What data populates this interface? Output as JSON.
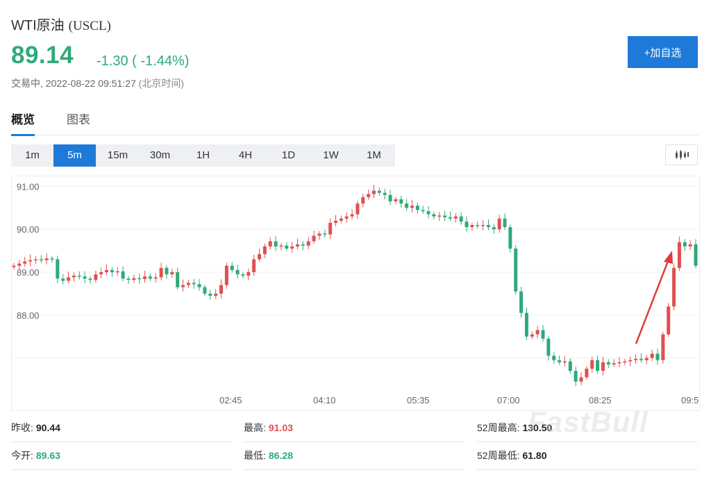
{
  "header": {
    "name": "WTI原油",
    "symbol": "(USCL)",
    "price": "89.14",
    "change": "-1.30 ( -1.44%)",
    "status": "交易中,",
    "timestamp": "2022-08-22 09:51:27",
    "timezone": "(北京时间)",
    "add_button": "+加自选"
  },
  "tabs": [
    {
      "label": "概览",
      "active": true
    },
    {
      "label": "图表",
      "active": false
    }
  ],
  "periods": [
    {
      "label": "1m",
      "active": false
    },
    {
      "label": "5m",
      "active": true
    },
    {
      "label": "15m",
      "active": false
    },
    {
      "label": "30m",
      "active": false
    },
    {
      "label": "1H",
      "active": false
    },
    {
      "label": "4H",
      "active": false
    },
    {
      "label": "1D",
      "active": false
    },
    {
      "label": "1W",
      "active": false
    },
    {
      "label": "1M",
      "active": false
    }
  ],
  "chart_type_icon": "candlestick-icon",
  "colors": {
    "up": "#e05050",
    "down": "#2eaa7a",
    "accent": "#1e7ad9"
  },
  "chart_data": {
    "type": "candlestick",
    "y_ticks": [
      "91.00",
      "90.00",
      "89.00",
      "88.00"
    ],
    "y_tick_values": [
      91,
      90,
      89,
      88
    ],
    "x_ticks": [
      "02:45",
      "04:10",
      "05:35",
      "07:00",
      "08:25",
      "09:5"
    ],
    "ylim": [
      86.2,
      91.25
    ],
    "close": [
      89.15,
      89.2,
      89.25,
      89.28,
      89.3,
      89.28,
      89.32,
      89.3,
      88.85,
      88.8,
      88.88,
      88.92,
      88.9,
      88.85,
      88.82,
      88.95,
      89.0,
      89.05,
      89.0,
      89.02,
      88.85,
      88.82,
      88.86,
      88.84,
      88.9,
      88.85,
      88.88,
      89.1,
      88.95,
      89.0,
      88.65,
      88.7,
      88.75,
      88.72,
      88.65,
      88.5,
      88.45,
      88.5,
      88.7,
      89.15,
      89.05,
      88.95,
      88.92,
      89.0,
      89.3,
      89.42,
      89.6,
      89.72,
      89.6,
      89.62,
      89.55,
      89.6,
      89.65,
      89.62,
      89.72,
      89.85,
      89.9,
      89.88,
      90.15,
      90.2,
      90.25,
      90.3,
      90.35,
      90.6,
      90.75,
      90.82,
      90.9,
      90.85,
      90.8,
      90.65,
      90.7,
      90.6,
      90.5,
      90.55,
      90.45,
      90.42,
      90.35,
      90.3,
      90.32,
      90.28,
      90.25,
      90.3,
      90.18,
      90.05,
      90.1,
      90.08,
      90.1,
      90.05,
      90.0,
      90.25,
      90.05,
      89.55,
      88.55,
      88.05,
      87.5,
      87.55,
      87.65,
      87.45,
      87.05,
      86.95,
      86.9,
      86.92,
      86.7,
      86.45,
      86.55,
      86.75,
      86.95,
      86.7,
      86.9,
      86.85,
      86.88,
      86.9,
      86.92,
      86.95,
      86.98,
      86.95,
      87.0,
      87.1,
      86.95,
      87.55,
      88.2,
      89.1,
      89.7,
      89.6,
      89.65,
      89.15
    ],
    "volume_note": ""
  },
  "stats": [
    {
      "label": "昨收:",
      "value": "90.44",
      "tone": "neutral"
    },
    {
      "label": "最高:",
      "value": "91.03",
      "tone": "up"
    },
    {
      "label": "52周最高:",
      "value": "130.50",
      "tone": "neutral"
    },
    {
      "label": "今开:",
      "value": "89.63",
      "tone": "down"
    },
    {
      "label": "最低:",
      "value": "86.28",
      "tone": "down"
    },
    {
      "label": "52周最低:",
      "value": "61.80",
      "tone": "neutral"
    }
  ],
  "watermark": "FastBull"
}
